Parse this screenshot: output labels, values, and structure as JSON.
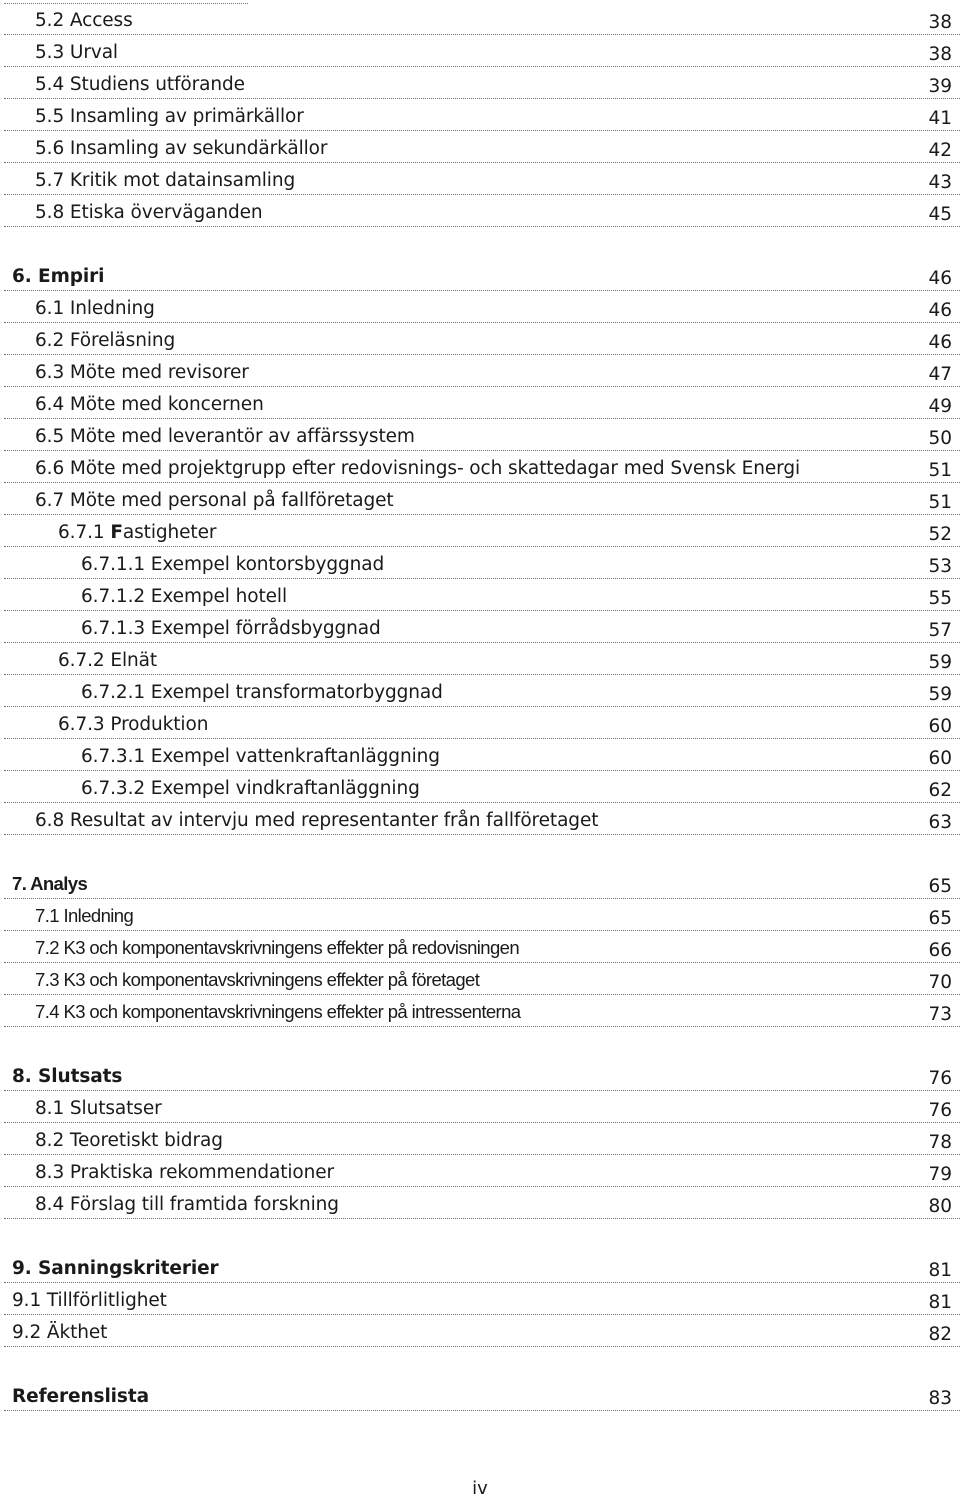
{
  "toc": {
    "section5": [
      {
        "title": "5.2 Access",
        "page": "38"
      },
      {
        "title": "5.3 Urval",
        "page": "38"
      },
      {
        "title": "5.4 Studiens utförande",
        "page": "39"
      },
      {
        "title": "5.5 Insamling av primärkällor",
        "page": "41"
      },
      {
        "title": "5.6 Insamling av sekundärkällor",
        "page": "42"
      },
      {
        "title": "5.7 Kritik mot datainsamling",
        "page": "43"
      },
      {
        "title": "5.8 Etiska överväganden",
        "page": "45"
      }
    ],
    "section6": {
      "heading": {
        "title": "6. Empiri",
        "page": "46"
      },
      "items": [
        {
          "title": "6.1 Inledning",
          "page": "46"
        },
        {
          "title": "6.2 Föreläsning",
          "page": "46"
        },
        {
          "title": "6.3 Möte med revisorer",
          "page": "47"
        },
        {
          "title": "6.4 Möte med koncernen",
          "page": "49"
        },
        {
          "title": "6.5 Möte med leverantör av affärssystem",
          "page": "50"
        },
        {
          "title": "6.6 Möte med projektgrupp efter redovisnings- och skattedagar med Svensk Energi",
          "page": "51"
        },
        {
          "title": "6.7 Möte med personal på fallföretaget",
          "page": "51"
        }
      ],
      "sub_671": {
        "number": "6.7.1 ",
        "initial": "F",
        "rest": "astigheter",
        "page": "52"
      },
      "sub_671_items": [
        {
          "title": "6.7.1.1 Exempel kontorsbyggnad",
          "page": "53"
        },
        {
          "title": "6.7.1.2 Exempel hotell",
          "page": "55"
        },
        {
          "title": "6.7.1.3 Exempel förrådsbyggnad",
          "page": "57"
        }
      ],
      "sub_672": {
        "title": "6.7.2 Elnät",
        "page": "59"
      },
      "sub_672_items": [
        {
          "title": "6.7.2.1 Exempel transformatorbyggnad",
          "page": "59"
        }
      ],
      "sub_673": {
        "title": "6.7.3 Produktion",
        "page": "60"
      },
      "sub_673_items": [
        {
          "title": "6.7.3.1 Exempel vattenkraftanläggning",
          "page": "60"
        },
        {
          "title": "6.7.3.2 Exempel vindkraftanläggning",
          "page": "62"
        }
      ],
      "item_68": {
        "title": "6.8 Resultat av intervju med representanter från fallföretaget",
        "page": "63"
      }
    },
    "section7": {
      "heading": {
        "title": "7. Analys",
        "page": "65"
      },
      "items": [
        {
          "title": "7.1 Inledning",
          "page": "65"
        },
        {
          "title": "7.2 K3 och komponentavskrivningens effekter på redovisningen",
          "page": "66"
        },
        {
          "title": "7.3 K3 och komponentavskrivningens effekter på företaget",
          "page": "70"
        },
        {
          "title": "7.4 K3 och komponentavskrivningens effekter på intressenterna",
          "page": "73"
        }
      ]
    },
    "section8": {
      "heading": {
        "title": "8. Slutsats",
        "page": "76"
      },
      "items": [
        {
          "title": "8.1 Slutsatser",
          "page": "76"
        },
        {
          "title": "8.2 Teoretiskt bidrag",
          "page": "78"
        },
        {
          "title": "8.3 Praktiska rekommendationer",
          "page": "79"
        },
        {
          "title": "8.4 Förslag till framtida forskning",
          "page": "80"
        }
      ]
    },
    "section9": {
      "heading": {
        "title": "9. Sanningskriterier",
        "page": "81"
      },
      "items": [
        {
          "title": "9.1 Tillförlitlighet",
          "page": "81"
        },
        {
          "title": "9.2 Äkthet",
          "page": "82"
        }
      ]
    },
    "references": {
      "title": "Referenslista",
      "page": "83"
    }
  },
  "footer": {
    "page_number": "iv"
  }
}
